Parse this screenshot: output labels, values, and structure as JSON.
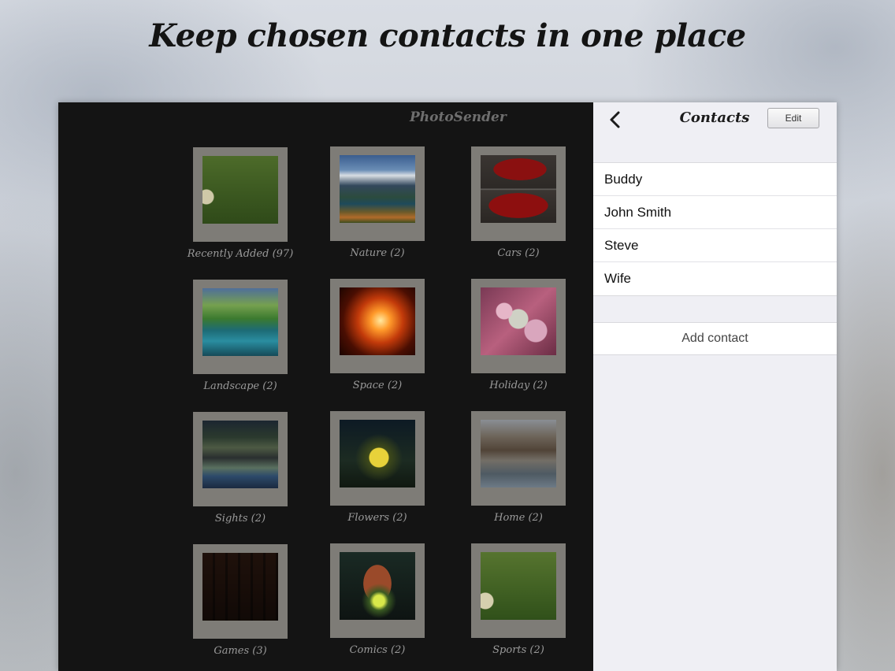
{
  "tagline": "Keep chosen contacts in one place",
  "gallery": {
    "title": "PhotoSender",
    "albums": [
      {
        "label": "Recently Added (97)",
        "icon": "grass-photo"
      },
      {
        "label": "Nature (2)",
        "icon": "mountain-lake-photo"
      },
      {
        "label": "Cars (2)",
        "icon": "red-car-photo"
      },
      {
        "label": "Landscape (2)",
        "icon": "waterfall-photo"
      },
      {
        "label": "Space (2)",
        "icon": "fiery-sun-photo"
      },
      {
        "label": "Holiday (2)",
        "icon": "cookies-photo"
      },
      {
        "label": "Sights (2)",
        "icon": "night-city-photo"
      },
      {
        "label": "Flowers (2)",
        "icon": "yellow-flower-photo"
      },
      {
        "label": "Home (2)",
        "icon": "house-photo"
      },
      {
        "label": "Games (3)",
        "icon": "game-covers-photo"
      },
      {
        "label": "Comics (2)",
        "icon": "comic-cover-photo"
      },
      {
        "label": "Sports (2)",
        "icon": "grass-ball-photo"
      }
    ]
  },
  "contacts_panel": {
    "back_icon": "chevron-left-icon",
    "title": "Contacts",
    "edit_label": "Edit",
    "contacts": [
      "Buddy",
      "John Smith",
      "Steve",
      "Wife"
    ],
    "add_contact_label": "Add contact"
  }
}
